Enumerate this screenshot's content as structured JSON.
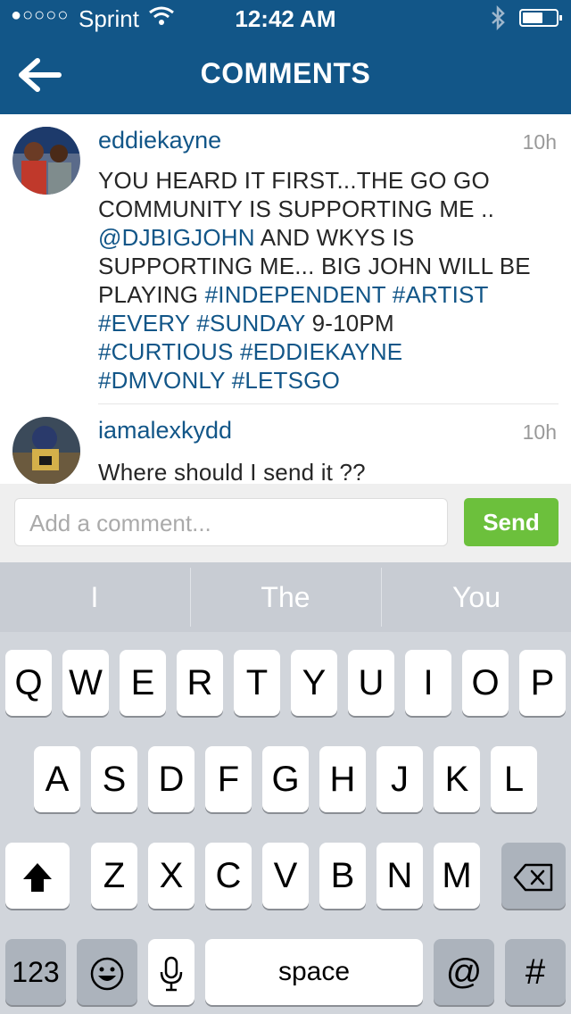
{
  "status_bar": {
    "signal": "●○○○○",
    "carrier": "Sprint",
    "time": "12:42 AM"
  },
  "nav": {
    "title": "COMMENTS",
    "back_icon": "arrow-left-icon"
  },
  "comments": [
    {
      "username": "eddiekayne",
      "time": "10h",
      "text_lines": [
        "YOU HEARD IT FIRST...THE GO GO",
        "COMMUNITY IS SUPPORTING ME ..",
        "SUPPORTING ME... BIG JOHN WILL BE"
      ],
      "mention": "@DJBIGJOHN",
      "after_mention": " AND WKYS IS",
      "playing": "PLAYING ",
      "tags": [
        "#INDEPENDENT",
        "#ARTIST",
        "#EVERY",
        "#SUNDAY",
        "#CURTIOUS",
        "#EDDIEKAYNE",
        "#DMVONLY",
        "#LETSGO"
      ],
      "time_text": " 9-10PM"
    },
    {
      "username": "iamalexkydd",
      "time": "10h",
      "text": "Where should I send it ??"
    }
  ],
  "compose": {
    "placeholder": "Add a comment...",
    "send_label": "Send"
  },
  "predictions": [
    "I",
    "The",
    "You"
  ],
  "keyboard": {
    "row1": [
      "Q",
      "W",
      "E",
      "R",
      "T",
      "Y",
      "U",
      "I",
      "O",
      "P"
    ],
    "row2": [
      "A",
      "S",
      "D",
      "F",
      "G",
      "H",
      "J",
      "K",
      "L"
    ],
    "row3": [
      "Z",
      "X",
      "C",
      "V",
      "B",
      "N",
      "M"
    ],
    "numbers_label": "123",
    "space_label": "space",
    "at_label": "@",
    "hash_label": "#"
  },
  "colors": {
    "brand": "#125688",
    "send": "#6cc03c"
  }
}
